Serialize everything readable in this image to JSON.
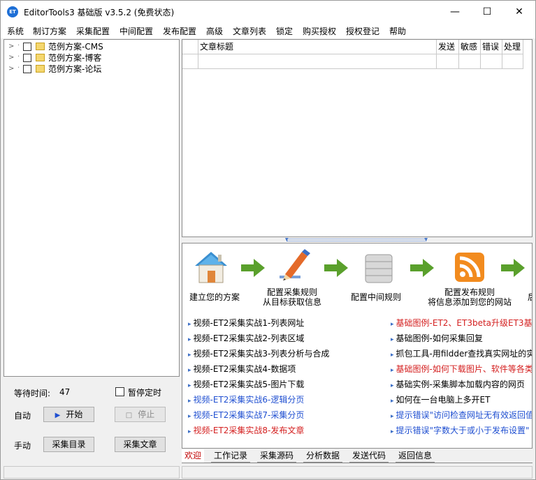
{
  "window": {
    "icon_text": "ET",
    "title": "EditorTools3 基础版 v3.5.2 (免费状态)",
    "minimize_glyph": "—",
    "maximize_glyph": "☐",
    "close_glyph": "✕"
  },
  "menu": [
    "系统",
    "制订方案",
    "采集配置",
    "中间配置",
    "发布配置",
    "高级",
    "文章列表",
    "锁定",
    "购买授权",
    "授权登记",
    "帮助"
  ],
  "tree": {
    "items": [
      {
        "label": "范例方案-CMS"
      },
      {
        "label": "范例方案-博客"
      },
      {
        "label": "范例方案-论坛"
      }
    ]
  },
  "controls": {
    "wait_label": "等待时间:",
    "wait_value": "47",
    "pause_label": "暂停定时",
    "auto_label": "自动",
    "start_label": "开始",
    "stop_label": "停止",
    "manual_label": "手动",
    "collect_dir_label": "采集目录",
    "collect_article_label": "采集文章"
  },
  "grid": {
    "columns": [
      "文章标题",
      "发送",
      "敏感",
      "错误",
      "处理"
    ]
  },
  "welcome": {
    "steps": [
      {
        "label": "建立您的方案"
      },
      {
        "label": "配置采集规则\n从目标获取信息"
      },
      {
        "label": "配置中间规则"
      },
      {
        "label": "配置发布规则\n将信息添加到您的网站"
      },
      {
        "label": "后"
      }
    ],
    "links_left": [
      {
        "text": "视频-ET2采集实战1-列表网址",
        "color": "#000000"
      },
      {
        "text": "视频-ET2采集实战2-列表区域",
        "color": "#000000"
      },
      {
        "text": "视频-ET2采集实战3-列表分析与合成",
        "color": "#000000"
      },
      {
        "text": "视频-ET2采集实战4-数据项",
        "color": "#000000"
      },
      {
        "text": "视频-ET2采集实战5-图片下载",
        "color": "#000000"
      },
      {
        "text": "视频-ET2采集实战6-逻辑分页",
        "color": "#1f4fd1"
      },
      {
        "text": "视频-ET2采集实战7-采集分页",
        "color": "#1f4fd1"
      },
      {
        "text": "视频-ET2采集实战8-发布文章",
        "color": "#d42020"
      }
    ],
    "links_right": [
      {
        "text": "基础图例-ET2、ET3beta升级ET3基",
        "color": "#d42020"
      },
      {
        "text": "基础图例-如何采集回复",
        "color": "#000000"
      },
      {
        "text": "抓包工具-用fildder查找真实网址的实",
        "color": "#000000"
      },
      {
        "text": "基础图例-如何下载图片、软件等各类",
        "color": "#d42020"
      },
      {
        "text": "基础实例-采集脚本加载内容的网页",
        "color": "#000000"
      },
      {
        "text": "如何在一台电脑上多开ET",
        "color": "#000000"
      },
      {
        "text": "提示错误\"访问检查网址无有效返回值",
        "color": "#1f4fd1"
      },
      {
        "text": "提示错误\"字数大于或小于发布设置\"",
        "color": "#1f4fd1"
      }
    ]
  },
  "tabs": [
    "欢迎",
    "工作记录",
    "采集源码",
    "分析数据",
    "发送代码",
    "返回信息"
  ],
  "colors": {
    "accent": "#1e6fd6",
    "arrow_green": "#5aa02c",
    "tab_active": "#c00000"
  }
}
